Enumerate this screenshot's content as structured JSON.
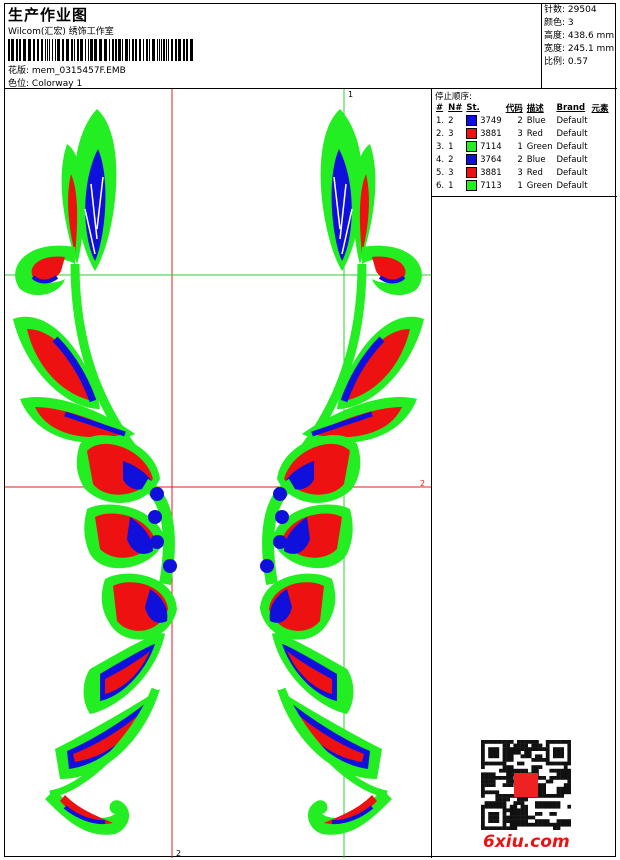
{
  "header": {
    "title": "生产作业图",
    "company": "Wilcom(汇宏) 绣饰工作室",
    "design_label": "花版: ",
    "design_name": "mem_0315457F.EMB",
    "colorway_label": "色位: ",
    "colorway_name": "Colorway 1"
  },
  "stats": [
    {
      "label": "针数:",
      "value": "29504"
    },
    {
      "label": "颜色:",
      "value": "3"
    },
    {
      "label": "高度:",
      "value": "438.6 mm"
    },
    {
      "label": "宽度:",
      "value": "245.1 mm"
    },
    {
      "label": "比例:",
      "value": "0.57"
    }
  ],
  "stop_sequence": {
    "title": "停止顺序:",
    "columns": [
      "#",
      "N#",
      "St.",
      "代码",
      "描述",
      "Brand",
      "元素"
    ],
    "rows": [
      {
        "idx": "1.",
        "n": "2",
        "color": "#1010dd",
        "code": "3749",
        "st": "2",
        "desc": "Blue",
        "brand": "Default"
      },
      {
        "idx": "2.",
        "n": "3",
        "color": "#ee1111",
        "code": "3881",
        "st": "3",
        "desc": "Red",
        "brand": "Default"
      },
      {
        "idx": "3.",
        "n": "1",
        "color": "#22ee22",
        "code": "7114",
        "st": "1",
        "desc": "Green",
        "brand": "Default"
      },
      {
        "idx": "4.",
        "n": "2",
        "color": "#1010dd",
        "code": "3764",
        "st": "2",
        "desc": "Blue",
        "brand": "Default"
      },
      {
        "idx": "5.",
        "n": "3",
        "color": "#ee1111",
        "code": "3881",
        "st": "3",
        "desc": "Red",
        "brand": "Default"
      },
      {
        "idx": "6.",
        "n": "1",
        "color": "#22ee22",
        "code": "7113",
        "st": "1",
        "desc": "Green",
        "brand": "Default"
      }
    ]
  },
  "guides": {
    "marker_1": "1",
    "marker_2": "2",
    "marker_2b": "2"
  },
  "watermark": "6xiu.com",
  "colors": {
    "green": "#22ee22",
    "red": "#ee1111",
    "blue": "#1010dd",
    "guide_red": "#dd2222",
    "guide_green": "#33cc33"
  }
}
